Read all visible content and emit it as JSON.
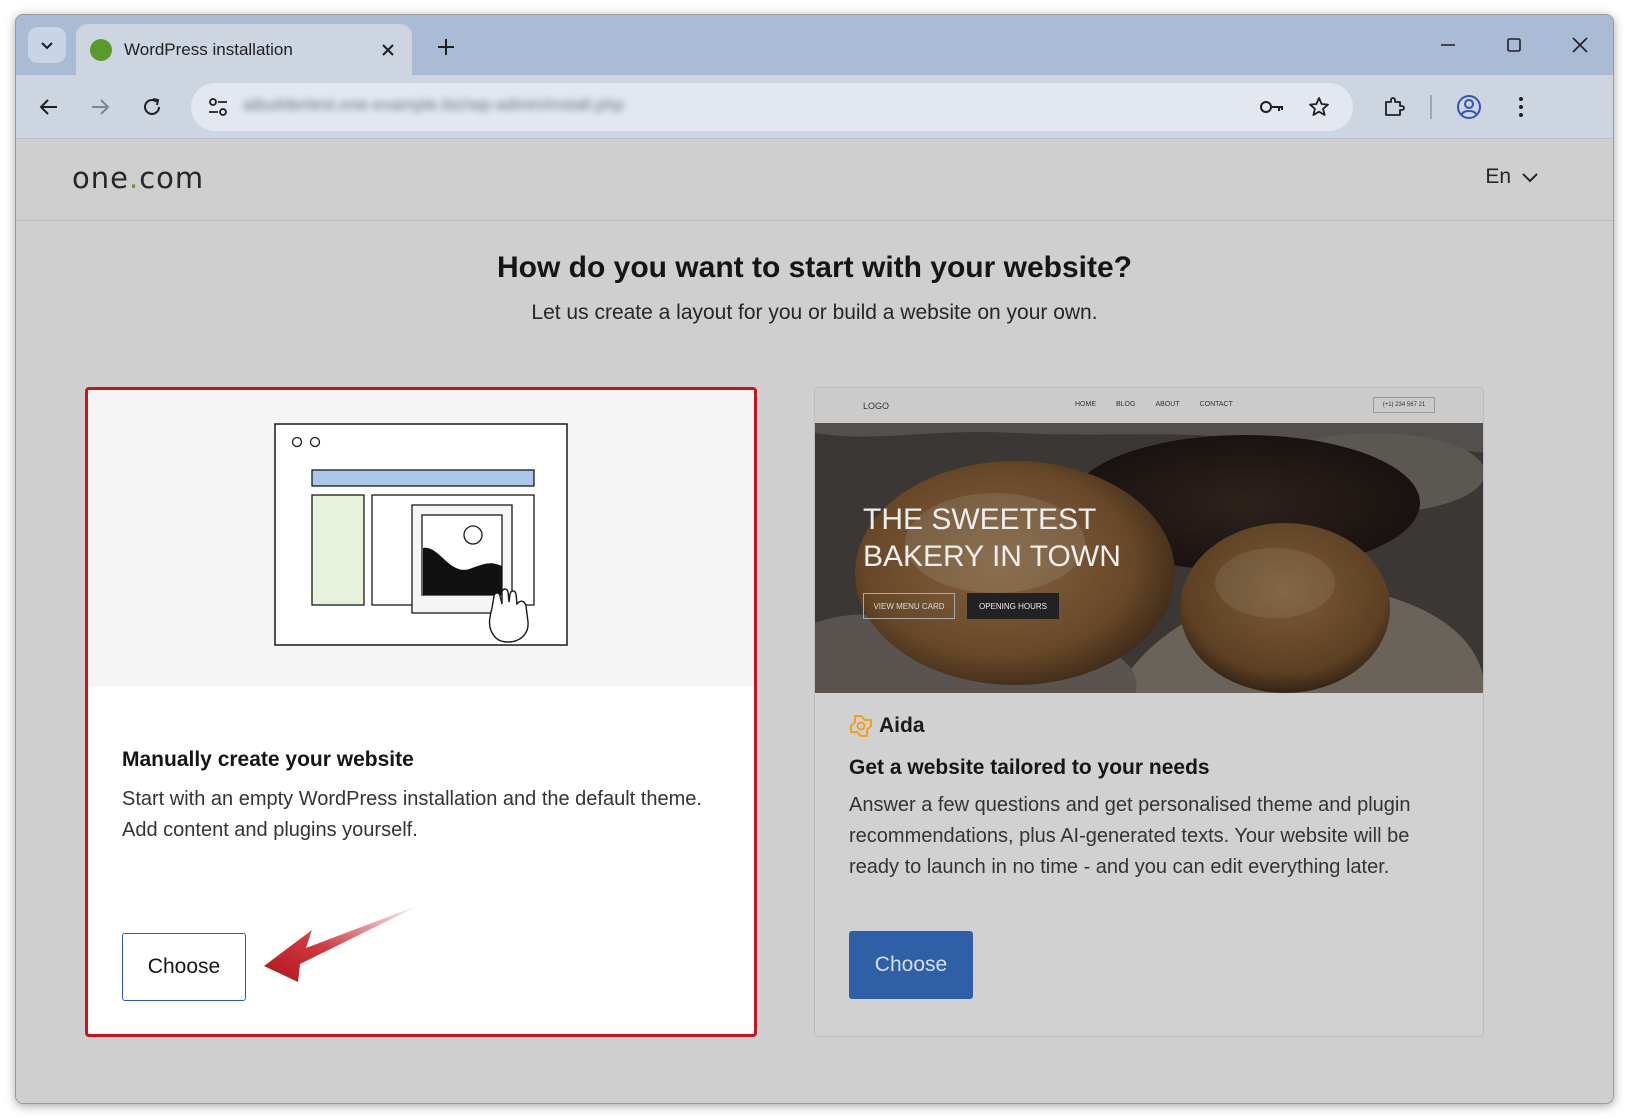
{
  "browser": {
    "tab_title": "WordPress installation",
    "url": "aibuildertest.one-example.biz/wp-admin/install.php"
  },
  "site": {
    "logo_main": "one",
    "logo_dot": ".",
    "logo_end": "com",
    "language": "En"
  },
  "page": {
    "headline": "How do you want to start with your website?",
    "subline": "Let us create a layout for you or build a website on your own."
  },
  "manual_card": {
    "title": "Manually create your website",
    "description": "Start with an empty WordPress installation and the default theme. Add content and plugins yourself.",
    "button_label": "Choose"
  },
  "aida_card": {
    "preview": {
      "logo": "LOGO",
      "nav": [
        "HOME",
        "BLOG",
        "ABOUT",
        "CONTACT"
      ],
      "phone": "(+1) 234 567 21",
      "headline_line1": "THE SWEETEST",
      "headline_line2": "BAKERY IN TOWN",
      "button1": "VIEW MENU CARD",
      "button2": "OPENING HOURS"
    },
    "brand": "Aida",
    "title": "Get a website tailored to your needs",
    "description": "Answer a few questions and get personalised theme and plugin recommendations, plus AI-generated texts. Your website will be ready to launch in no time - and you can edit everything later.",
    "button_label": "Choose"
  },
  "colors": {
    "highlight_border": "#c4161c",
    "primary_button": "#2f5fa6",
    "logo_dot": "#5a9a2a",
    "arrow": "#b0141c"
  }
}
